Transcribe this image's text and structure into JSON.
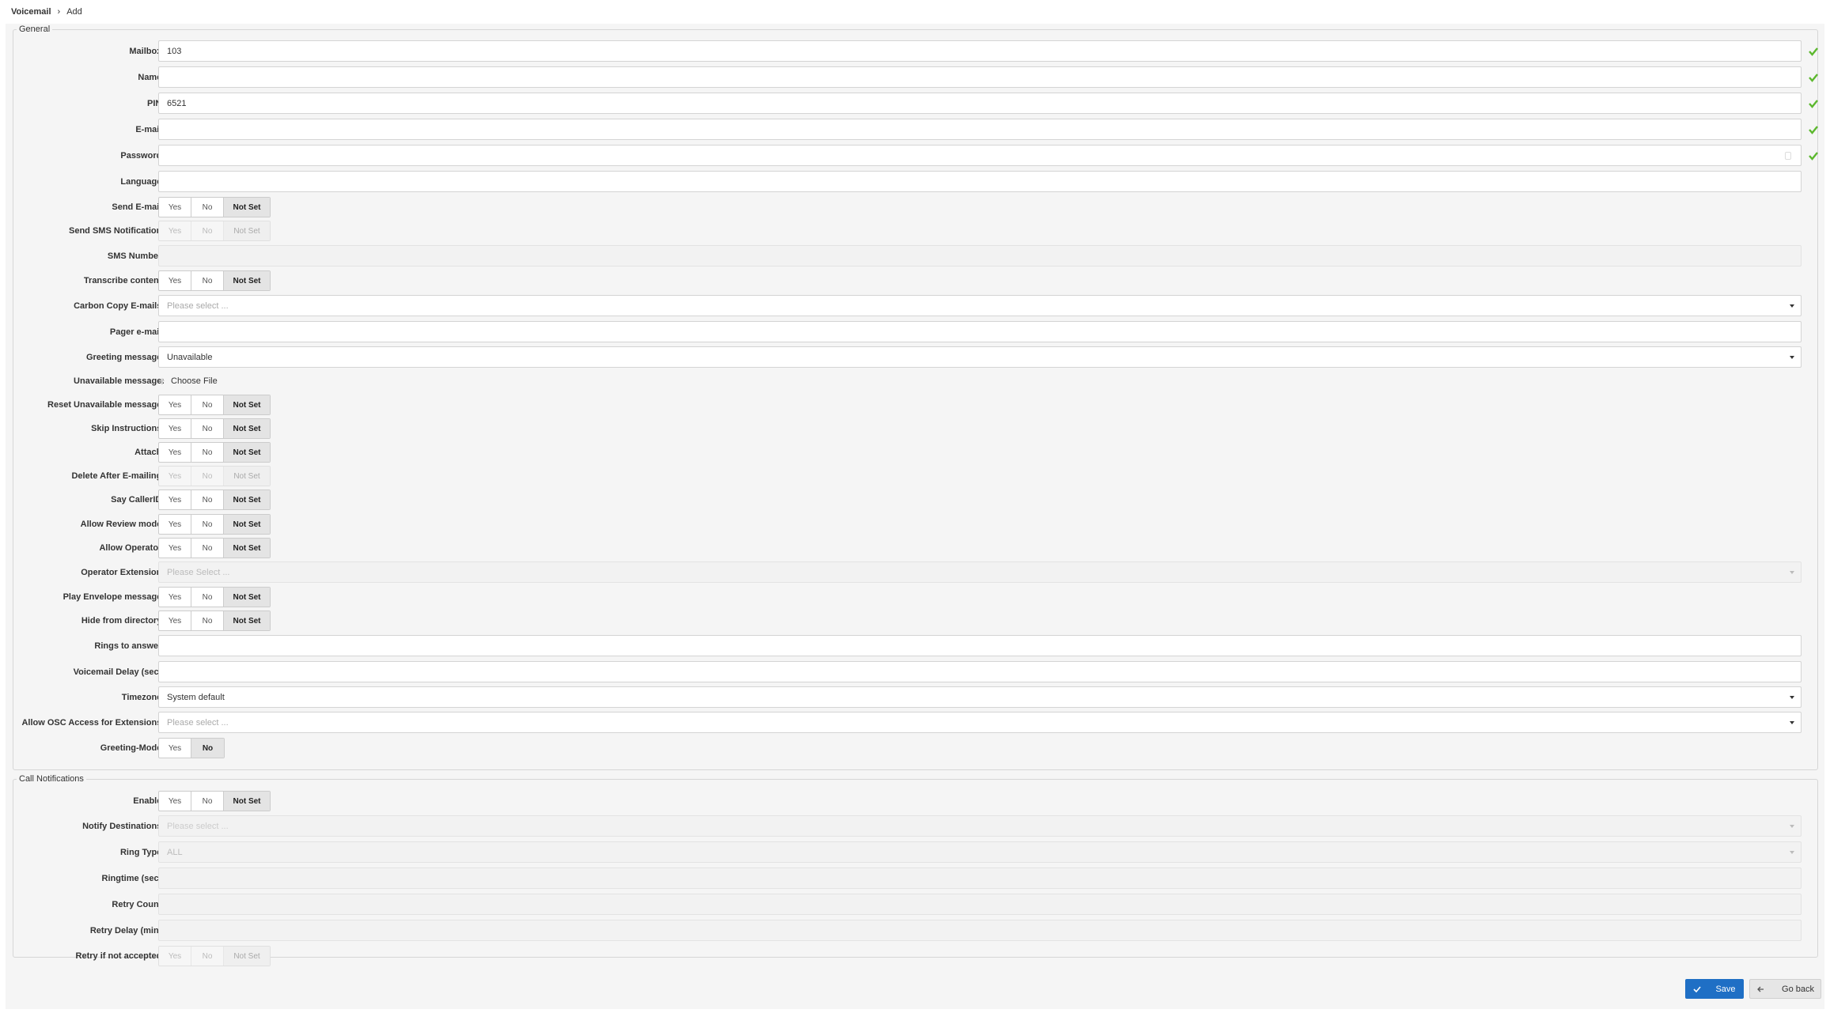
{
  "breadcrumb": {
    "root": "Voicemail",
    "current": "Add"
  },
  "general": {
    "legend": "General",
    "mailbox": {
      "label": "Mailbox:",
      "value": "103"
    },
    "name": {
      "label": "Name:",
      "value": ""
    },
    "pin": {
      "label": "PIN:",
      "value": "6521"
    },
    "email": {
      "label": "E-mail:",
      "value": ""
    },
    "password": {
      "label": "Password:",
      "value": ""
    },
    "language": {
      "label": "Language:",
      "value": ""
    },
    "send_email": {
      "label": "Send E-mail:"
    },
    "send_sms": {
      "label": "Send SMS Notification:"
    },
    "sms_number": {
      "label": "SMS Number:"
    },
    "transcribe": {
      "label": "Transcribe content:"
    },
    "cc_emails": {
      "label": "Carbon Copy E-mails:",
      "placeholder": "Please select ..."
    },
    "pager_email": {
      "label": "Pager e-mail:"
    },
    "greeting_message": {
      "label": "Greeting message:",
      "value": "Unavailable"
    },
    "unavailable_message": {
      "label": "Unavailable message:",
      "file_button": "Choose File"
    },
    "reset_unavailable": {
      "label": "Reset Unavailable message:"
    },
    "skip_instructions": {
      "label": "Skip Instructions:"
    },
    "attach": {
      "label": "Attach:"
    },
    "delete_after": {
      "label": "Delete After E-mailing:"
    },
    "say_callerid": {
      "label": "Say CallerID:"
    },
    "review_mode": {
      "label": "Allow Review mode:"
    },
    "allow_operator": {
      "label": "Allow Operator:"
    },
    "operator_ext": {
      "label": "Operator Extension:",
      "placeholder": "Please Select ..."
    },
    "play_envelope": {
      "label": "Play Envelope message:"
    },
    "hide_directory": {
      "label": "Hide from directory:"
    },
    "rings": {
      "label": "Rings to answer:"
    },
    "vm_delay": {
      "label": "Voicemail Delay (sec):"
    },
    "timezone": {
      "label": "Timezone:",
      "value": "System default"
    },
    "osc_access": {
      "label": "Allow OSC Access for Extensions:",
      "placeholder": "Please select ..."
    },
    "greeting_mode": {
      "label": "Greeting-Mode:"
    }
  },
  "toggle": {
    "yes": "Yes",
    "no": "No",
    "not_set": "Not Set"
  },
  "notifications": {
    "legend": "Call Notifications",
    "enable": {
      "label": "Enable:"
    },
    "destinations": {
      "label": "Notify Destinations:",
      "placeholder": "Please select ..."
    },
    "ring_type": {
      "label": "Ring Type:",
      "value": "ALL"
    },
    "ringtime": {
      "label": "Ringtime (sec):"
    },
    "retry_count": {
      "label": "Retry Count:"
    },
    "retry_delay": {
      "label": "Retry Delay (min):"
    },
    "retry_accept": {
      "label": "Retry if not accepted:"
    }
  },
  "actions": {
    "save": "Save",
    "back": "Go back"
  },
  "colors": {
    "accent": "#1f6fc5",
    "check": "#5cb82e"
  }
}
